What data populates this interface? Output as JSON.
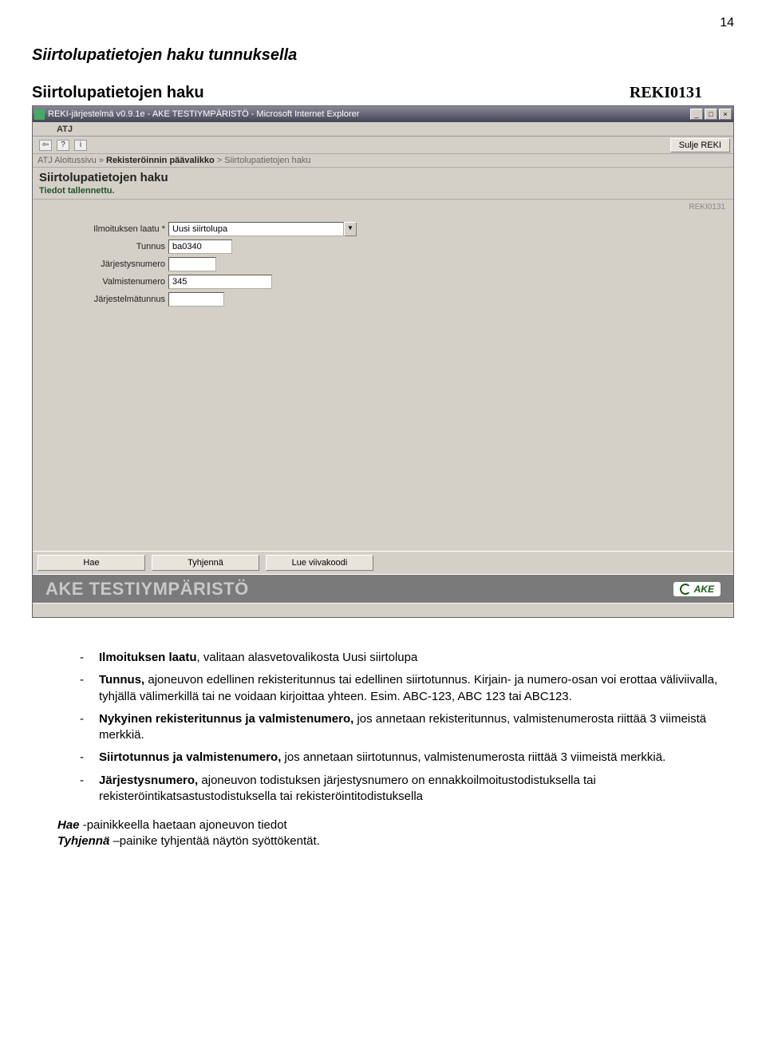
{
  "page_number": "14",
  "heading_main": "Siirtolupatietojen haku tunnuksella",
  "subheading_label": "Siirtolupatietojen haku",
  "subheading_code": "REKI0131",
  "window": {
    "title": "REKI-järjestelmä v0.9.1e - AKE TESTIYMPÄRISTÖ - Microsoft Internet Explorer",
    "atj_label": "ATJ",
    "sulje_btn": "Sulje REKI",
    "breadcrumb_plain1": "ATJ Aloitussivu » ",
    "breadcrumb_bold": "Rekisteröinnin päävalikko",
    "breadcrumb_plain2": " > Siirtolupatietojen haku",
    "page_title": "Siirtolupatietojen haku",
    "status": "Tiedot tallennettu.",
    "form_code": "REKI0131",
    "fields": {
      "ilmoituksen_laatu": {
        "label": "Ilmoituksen laatu *",
        "value": "Uusi siirtolupa"
      },
      "tunnus": {
        "label": "Tunnus",
        "value": "ba0340"
      },
      "jarjestysnumero": {
        "label": "Järjestysnumero",
        "value": ""
      },
      "valmistenumero": {
        "label": "Valmistenumero",
        "value": "345"
      },
      "jarjestelmatunnus": {
        "label": "Järjestelmätunnus",
        "value": ""
      }
    },
    "buttons": {
      "hae": "Hae",
      "tyhjenna": "Tyhjennä",
      "lue": "Lue viivakoodi"
    },
    "env_text": "AKE TESTIYMPÄRISTÖ",
    "ake_logo": "AKE"
  },
  "bullets": {
    "b1_bold": "Ilmoituksen laatu",
    "b1_text": ", valitaan alasvetovalikosta Uusi siirtolupa",
    "b2_bold": "Tunnus,",
    "b2_text": " ajoneuvon edellinen rekisteritunnus tai edellinen siirtotunnus. Kirjain- ja numero-osan voi erottaa väliviivalla, tyhjällä välimerkillä tai ne voidaan kirjoittaa yhteen. Esim. ABC-123, ABC 123 tai ABC123.",
    "b3_bold": "Nykyinen rekisteritunnus ja valmistenumero,",
    "b3_text": " jos annetaan rekisteritunnus, valmistenumerosta riittää 3 viimeistä merkkiä.",
    "b4_bold": "Siirtotunnus ja valmistenumero,",
    "b4_text": " jos annetaan siirtotunnus, valmistenumerosta riittää 3 viimeistä merkkiä.",
    "b5_bold": "Järjestysnumero,",
    "b5_text": " ajoneuvon todistuksen järjestysnumero on ennakkoilmoitustodistuksella tai rekisteröintikatsastustodistuksella tai rekisteröintitodistuksella"
  },
  "para1_bi": "Hae",
  "para1_rest": " -painikkeella haetaan ajoneuvon tiedot",
  "para2_bi": "Tyhjennä",
  "para2_rest": " –painike tyhjentää näytön syöttökentät."
}
